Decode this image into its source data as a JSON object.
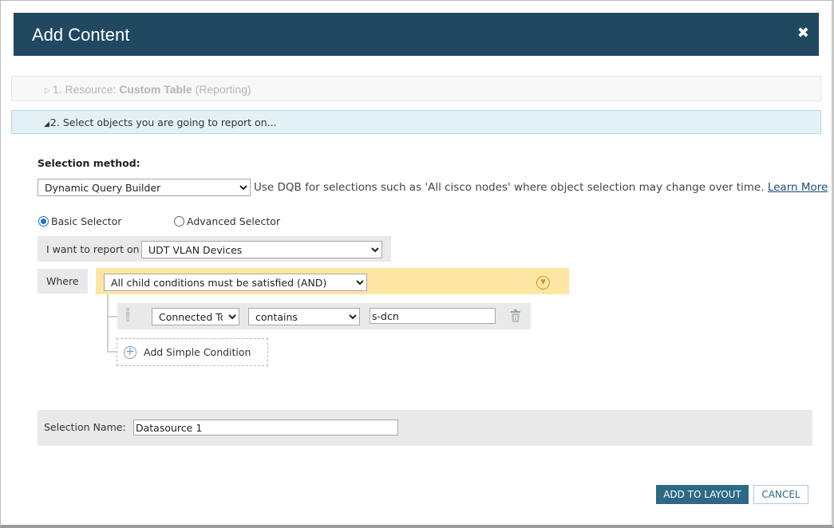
{
  "dialog": {
    "title": "Add Content",
    "close_glyph": "✖"
  },
  "steps": {
    "step1": {
      "prefix": "1. Resource: ",
      "resource": "Custom Table",
      "suffix": " (Reporting)"
    },
    "step2": {
      "label": "2. Select objects you are going to report on..."
    }
  },
  "selection_method": {
    "label": "Selection method:",
    "value": "Dynamic Query Builder",
    "description": "Use DQB for selections such as 'All cisco nodes' where object selection may change over time. ",
    "learn_more": "Learn More"
  },
  "selector_mode": {
    "basic": "Basic Selector",
    "advanced": "Advanced Selector",
    "selected": "basic"
  },
  "report_on": {
    "label": "I want to report on",
    "value": "UDT VLAN Devices"
  },
  "where": {
    "label": "Where",
    "condition_mode": "All child conditions must be satisfied (AND)",
    "menu_icon": "chevron-down-circle-icon",
    "conditions": [
      {
        "field": "Connected To",
        "operator": "contains",
        "value": "s-dcn"
      }
    ],
    "add_condition_label": "Add Simple Condition"
  },
  "selection_name": {
    "label": "Selection Name:",
    "value": "Datasource 1"
  },
  "buttons": {
    "add_to_layout": "ADD TO LAYOUT",
    "cancel": "CANCEL"
  },
  "colors": {
    "title_bar": "#204861",
    "condition_group": "#fde6a3",
    "primary_button": "#2d6985",
    "step_active_bg": "#e3f1f7"
  }
}
